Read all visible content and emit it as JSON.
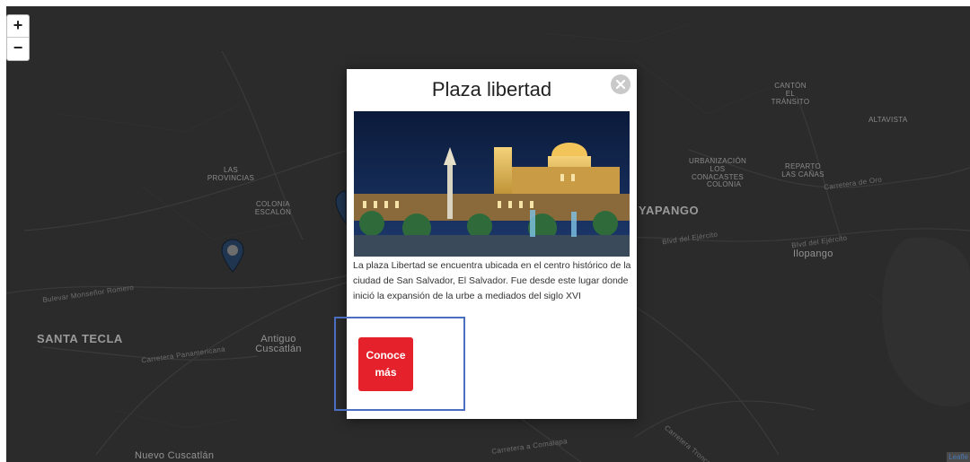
{
  "map": {
    "zoom_in": "+",
    "zoom_out": "−",
    "labels": {
      "las_provincias": "LAS PROVINCIAS",
      "colonia_escalon": "COLONIA ESCALÓN",
      "santa_tecla": "SANTA TECLA",
      "antiguo_cuscatlan": "Antiguo Cuscatlán",
      "soyapango": "YAPANGO",
      "ilopango": "Ilopango",
      "canton_el_transito": "Cantón El Tránsito",
      "altavista": "Altavista",
      "urbanizacion": "Urbanización Los Conacastes",
      "reparto_las_canas": "Reparto Las Cañas",
      "colonia_partial": "COLONIA",
      "nuevo_cuscatlan": "Nuevo Cuscatlán",
      "road_bulevar_monsenor": "Bulevar Monseñor Romero",
      "road_carretera_panamericana": "Carretera Panamericana",
      "road_blvd_del_ejercito": "Blvd del Ejército",
      "road_blvd_del_ejercito_2": "Blvd del Ejército",
      "road_carretera_oro": "Carretera de Oro",
      "road_comalapa": "Carretera a Comalapa",
      "road_troncal": "Carretera Troncal"
    },
    "attribution": "Leafle"
  },
  "popup": {
    "title": "Plaza libertad",
    "description": "La plaza Libertad se encuentra ubicada en el centro histórico de la ciudad de San Salvador, El Salvador. Fue desde este lugar donde inició la expansión de la urbe a mediados del siglo XVI",
    "button_line1": "Conoce",
    "button_line2": "más"
  },
  "colors": {
    "map_bg": "#2b2b2b",
    "button": "#e5212b",
    "highlight": "#4a6fc0",
    "marker": "#1f3550"
  }
}
